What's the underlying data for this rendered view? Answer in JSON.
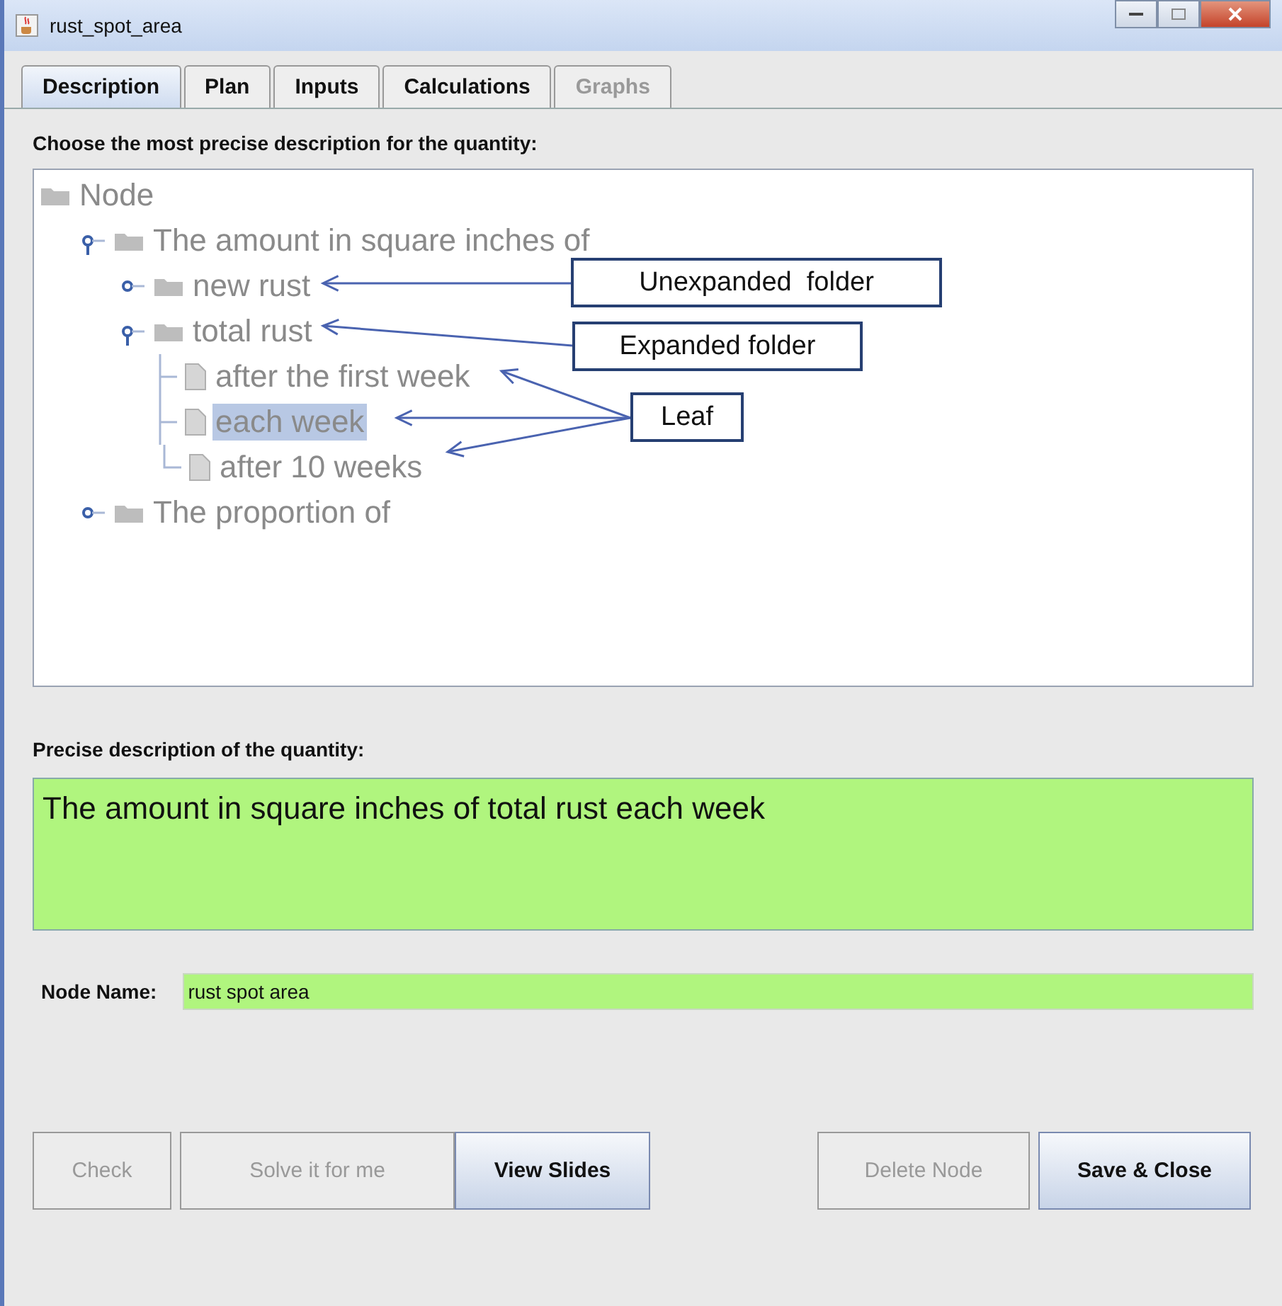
{
  "window": {
    "title": "rust_spot_area"
  },
  "tabs": [
    {
      "label": "Description",
      "selected": true,
      "disabled": false
    },
    {
      "label": "Plan",
      "selected": false,
      "disabled": false
    },
    {
      "label": "Inputs",
      "selected": false,
      "disabled": false
    },
    {
      "label": "Calculations",
      "selected": false,
      "disabled": false
    },
    {
      "label": "Graphs",
      "selected": false,
      "disabled": true
    }
  ],
  "tree_label": "Choose the most precise description for the quantity:",
  "tree": {
    "label": "Node",
    "kind": "folder",
    "selected": false,
    "children": [
      {
        "label": "The amount in square inches of",
        "kind": "folder",
        "expanded": true,
        "selected": false,
        "children": [
          {
            "label": "new rust",
            "kind": "folder",
            "expanded": false,
            "selected": false
          },
          {
            "label": "total rust",
            "kind": "folder",
            "expanded": true,
            "selected": false,
            "children": [
              {
                "label": "after the first week",
                "kind": "leaf",
                "selected": false
              },
              {
                "label": "each week",
                "kind": "leaf",
                "selected": true
              },
              {
                "label": "after 10 weeks",
                "kind": "leaf",
                "selected": false
              }
            ]
          }
        ]
      },
      {
        "label": "The proportion of",
        "kind": "folder",
        "expanded": false,
        "selected": false
      }
    ]
  },
  "annotations": [
    "Unexpanded  folder",
    "Expanded folder",
    "Leaf"
  ],
  "description_label": "Precise description of the quantity:",
  "description": "The amount in square inches of total rust each week",
  "node_name": {
    "label": "Node Name:",
    "value": "rust spot area"
  },
  "buttons": [
    {
      "label": "Check",
      "disabled": true,
      "primary": false
    },
    {
      "label": "Solve it for me",
      "disabled": true,
      "primary": false
    },
    {
      "label": "View Slides",
      "disabled": false,
      "primary": true
    },
    {
      "label": "Delete Node",
      "disabled": true,
      "primary": false
    },
    {
      "label": "Save & Close",
      "disabled": false,
      "primary": true
    }
  ]
}
